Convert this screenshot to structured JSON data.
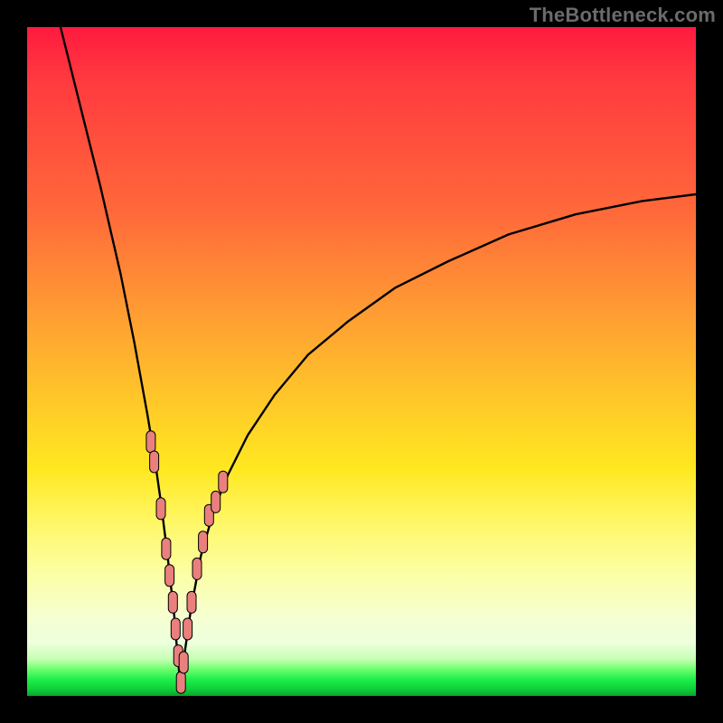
{
  "watermark": {
    "text": "TheBottleneck.com"
  },
  "colors": {
    "curve": "#000000",
    "marker_fill": "#e9807e",
    "marker_stroke": "#000000"
  },
  "chart_data": {
    "type": "line",
    "title": "",
    "xlabel": "",
    "ylabel": "",
    "xlim": [
      0,
      100
    ],
    "ylim": [
      0,
      100
    ],
    "grid": false,
    "legend": "none",
    "background": "heatmap-vertical red→yellow→green",
    "series": [
      {
        "name": "bottleneck-curve",
        "description": "V-shaped curve: steep descent from top-left to a minimum near x≈23, then rising concave toward top-right, reaching ~y≈75 at x=100.",
        "x": [
          5,
          8,
          11,
          14,
          16,
          18,
          19,
          20,
          21,
          22,
          22.5,
          23,
          23.5,
          24.5,
          26,
          28,
          30,
          33,
          37,
          42,
          48,
          55,
          63,
          72,
          82,
          92,
          100
        ],
        "y": [
          100,
          88,
          76,
          63,
          53,
          42,
          36,
          29,
          21,
          12,
          6,
          1,
          6,
          13,
          21,
          28,
          33,
          39,
          45,
          51,
          56,
          61,
          65,
          69,
          72,
          74,
          75
        ]
      }
    ],
    "markers": {
      "name": "highlighted-points",
      "shape": "rounded-bar",
      "fill": "#e9807e",
      "stroke": "#000000",
      "points_x": [
        18.5,
        19.0,
        20.0,
        20.8,
        21.3,
        21.8,
        22.2,
        22.6,
        23.0,
        23.4,
        24.0,
        24.6,
        25.4,
        26.3,
        27.2,
        28.2,
        29.3
      ],
      "points_y": [
        38,
        35,
        28,
        22,
        18,
        14,
        10,
        6,
        2,
        5,
        10,
        14,
        19,
        23,
        27,
        29,
        32
      ]
    }
  }
}
